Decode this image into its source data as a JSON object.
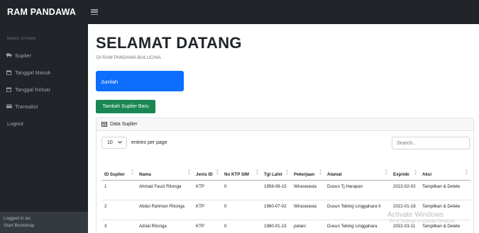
{
  "brand": "RAM PANDAWA",
  "sidebar": {
    "heading": "MENU UTAMA",
    "items": [
      {
        "label": "Suplier",
        "icon": "truck-icon"
      },
      {
        "label": "Tanggal Masuk",
        "icon": "calendar-icon"
      },
      {
        "label": "Tanggal Keluar",
        "icon": "calendar-icon"
      },
      {
        "label": "Transaksi",
        "icon": "card-icon"
      },
      {
        "label": "Logout",
        "icon": ""
      }
    ],
    "footer": {
      "line1": "Logged in as:",
      "line2": "Start Bootstrap"
    }
  },
  "main": {
    "title": "SELAMAT DATANG",
    "subtitle": "DI RAM PANDAWA BULUCINA",
    "card_label": "Jumlah",
    "add_button": "Tambah Suplier Baru",
    "panel_title": "Data Suplier",
    "entries_value": "10",
    "entries_label": "entries per page",
    "search_placeholder": "Search..."
  },
  "table": {
    "headers": [
      "ID Suplier",
      "Nama",
      "Jenis ID",
      "No KTP SIM",
      "Tgl Lahir",
      "Pekerjaan",
      "Alamat",
      "Expride",
      "Aksi"
    ],
    "rows": [
      [
        "1",
        "Ahmad Fauzi Ritonga",
        "KTP",
        "0",
        "1958-08-15",
        "Wiraswasta",
        "Dusun Tj.Harapan",
        "2022-02-02",
        "Tampilkan & Delete"
      ],
      [
        "2",
        "Abdul Rahman Ritonga",
        "KTP",
        "0",
        "1960-07-02",
        "Wiraswasta",
        "Dusun Tebing Linggahara II",
        "2022-01-18",
        "Tampilkan & Delete"
      ],
      [
        "3",
        "Adrial Ritonga",
        "KTP",
        "0",
        "1980-01-15",
        "petani",
        "Dusun Tebing Linggahara",
        "2022-03-11",
        "Tampilkan & Delete"
      ]
    ]
  },
  "watermark": {
    "line1": "Activate Windows",
    "line2": "Go to Settings to activate Windows."
  },
  "colors": {
    "topbar": "#212529",
    "primary": "#0d6efd",
    "success": "#198754"
  }
}
